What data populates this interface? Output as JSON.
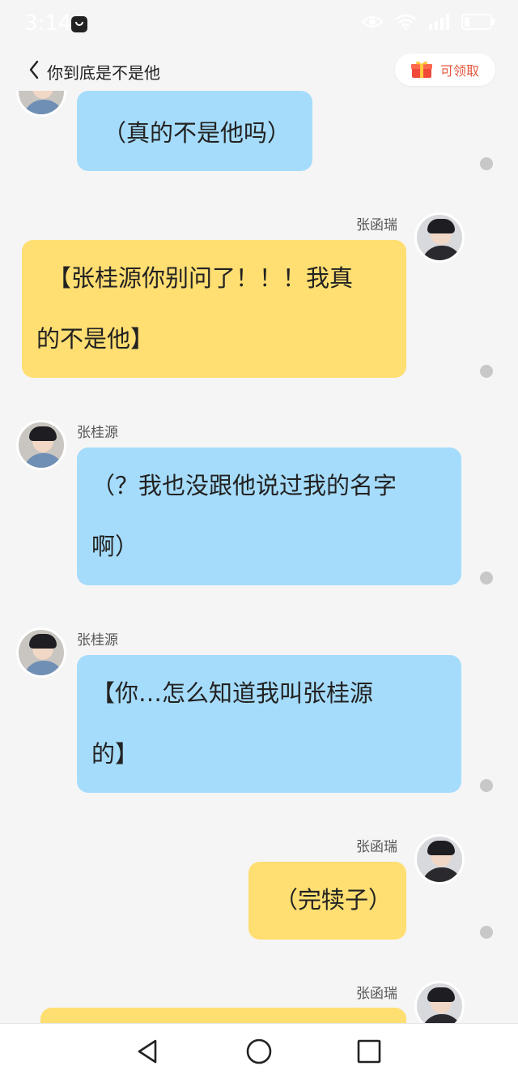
{
  "status_bar": {
    "time": "3:14",
    "icons": [
      "eye-icon",
      "wifi-icon",
      "signal-icon",
      "battery-icon"
    ]
  },
  "header": {
    "title": "你到底是不是他",
    "reward_label": "可领取"
  },
  "messages": [
    {
      "sender": "",
      "side": "left",
      "color": "#a6dcfb",
      "lines": [
        "（真的不是他吗）"
      ]
    },
    {
      "sender": "张函瑞",
      "side": "right",
      "color": "#ffde72",
      "lines": [
        "【张桂源你别问了！！！我真",
        "的不是他】"
      ]
    },
    {
      "sender": "张桂源",
      "side": "left",
      "color": "#a6dcfb",
      "lines": [
        "（？我也没跟他说过我的名字",
        "啊）"
      ]
    },
    {
      "sender": "张桂源",
      "side": "left",
      "color": "#a6dcfb",
      "lines": [
        "【你…怎么知道我叫张桂源",
        "的】"
      ]
    },
    {
      "sender": "张函瑞",
      "side": "right",
      "color": "#ffde72",
      "lines": [
        "（完犊子）"
      ]
    },
    {
      "sender": "张函瑞",
      "side": "right",
      "color": "#ffde72",
      "lines": [
        ""
      ]
    }
  ],
  "colors": {
    "left_bubble": "#a6dcfb",
    "right_bubble": "#ffde72",
    "background": "#f5f5f5",
    "reward_text": "#e4573d"
  },
  "bottom_nav": {
    "icons": [
      "back-triangle-icon",
      "home-circle-icon",
      "recents-square-icon"
    ]
  }
}
